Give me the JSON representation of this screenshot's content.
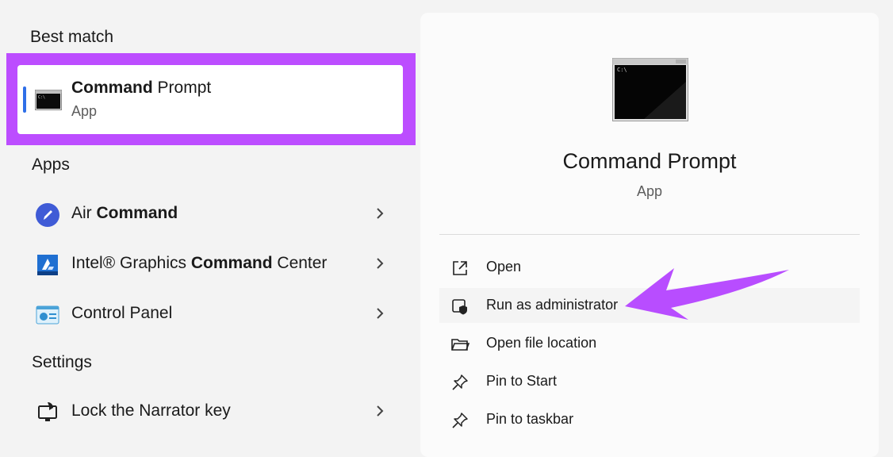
{
  "sections": {
    "best_match": "Best match",
    "apps": "Apps",
    "settings": "Settings"
  },
  "best_match": {
    "title_bold": "Command",
    "title_rest": " Prompt",
    "subtitle": "App",
    "icon": "command-prompt-icon"
  },
  "apps": [
    {
      "pre": "Air ",
      "bold": "Command",
      "post": "",
      "icon": "air-command-icon"
    },
    {
      "pre": "Intel® Graphics ",
      "bold": "Command",
      "post": " Center",
      "icon": "intel-graphics-icon"
    },
    {
      "pre": "Control Panel",
      "bold": "",
      "post": "",
      "icon": "control-panel-icon"
    }
  ],
  "settings": [
    {
      "pre": "Lock the Narrator key",
      "bold": "",
      "post": "",
      "icon": "narrator-icon"
    }
  ],
  "detail": {
    "title": "Command Prompt",
    "subtitle": "App",
    "actions": [
      {
        "label": "Open",
        "icon": "open-external-icon"
      },
      {
        "label": "Run as administrator",
        "icon": "shield-admin-icon"
      },
      {
        "label": "Open file location",
        "icon": "folder-icon"
      },
      {
        "label": "Pin to Start",
        "icon": "pin-icon"
      },
      {
        "label": "Pin to taskbar",
        "icon": "pin-icon"
      }
    ]
  },
  "colors": {
    "highlight_frame": "#bc4dff",
    "selection_accent": "#2f6fe8",
    "annotation_arrow": "#b84dff"
  }
}
